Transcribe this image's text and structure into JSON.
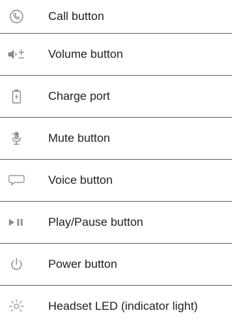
{
  "legend": {
    "items": [
      {
        "icon": "phone-icon",
        "label": "Call button"
      },
      {
        "icon": "volume-icon",
        "label": "Volume button"
      },
      {
        "icon": "battery-charge-icon",
        "label": "Charge port"
      },
      {
        "icon": "mute-microphone-icon",
        "label": "Mute button"
      },
      {
        "icon": "speech-bubble-icon",
        "label": "Voice button"
      },
      {
        "icon": "play-pause-icon",
        "label": "Play/Pause button"
      },
      {
        "icon": "power-icon",
        "label": "Power button"
      },
      {
        "icon": "led-light-icon",
        "label": "Headset LED (indicator light)"
      }
    ]
  },
  "colors": {
    "icon": "#8a8a8a",
    "text": "#1f1f1f",
    "divider": "#666666"
  }
}
